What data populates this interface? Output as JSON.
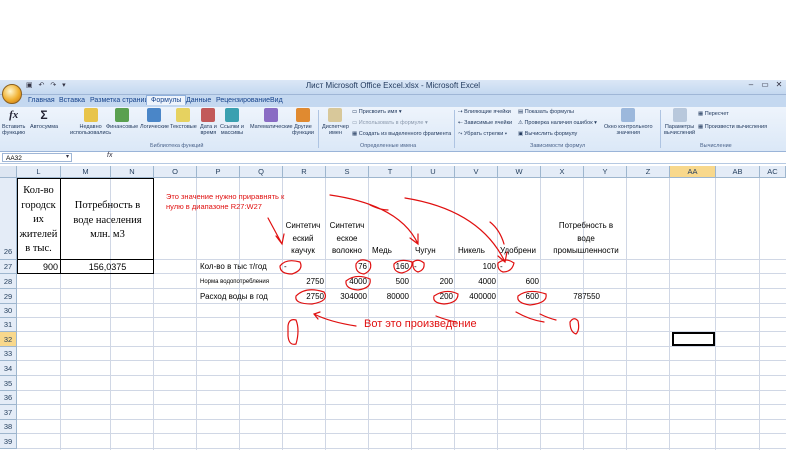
{
  "window": {
    "title": "Лист Microsoft Office Excel.xlsx - Microsoft Excel",
    "controls": [
      "–",
      "▭",
      "✕"
    ]
  },
  "tabs": [
    "Главная",
    "Вставка",
    "Разметка страницы",
    "Формулы",
    "Данные",
    "Рецензирование",
    "Вид"
  ],
  "ribbon": {
    "insert_function": [
      "Вставить",
      "функцию"
    ],
    "autosum": "Автосумма",
    "recent": [
      "Недавно",
      "использовались"
    ],
    "financial": "Финансовые",
    "logical": "Логические",
    "text": "Текстовые",
    "datetime": [
      "Дата и",
      "время"
    ],
    "lookup": [
      "Ссылки и",
      "массивы"
    ],
    "math": "Математические",
    "more": [
      "Другие",
      "функции"
    ],
    "group_library": "Библиотека функций",
    "name_manager": [
      "Диспетчер",
      "имен"
    ],
    "define_name": "Присвоить имя",
    "use_in_formula": "Использовать в формуле",
    "create_from_selection": "Создать из выделенного фрагмента",
    "group_names": "Определенные имена",
    "trace_precedents": "Влияющие ячейки",
    "trace_dependents": "Зависимые ячейки",
    "remove_arrows": "Убрать стрелки",
    "show_formulas": "Показать формулы",
    "error_checking": "Проверка наличия ошибок",
    "evaluate_formula": "Вычислить формулу",
    "group_audit": "Зависимости формул",
    "watch_window": [
      "Окно контрольного",
      "значения"
    ],
    "calc_options": [
      "Параметры",
      "вычислений"
    ],
    "calc_now": "Пересчет",
    "calc_sheet": "Произвести вычисления",
    "group_calc": "Вычисление"
  },
  "formula_bar": {
    "name_box": "AA32",
    "fx": "fx"
  },
  "columns": [
    "L",
    "M",
    "N",
    "O",
    "P",
    "Q",
    "R",
    "S",
    "T",
    "U",
    "V",
    "W",
    "X",
    "Y",
    "Z",
    "AA",
    "AB",
    "AC"
  ],
  "selected_column": "AA",
  "rows": [
    "26",
    "27",
    "28",
    "29",
    "30",
    "31",
    "32",
    "33",
    "34",
    "35",
    "36",
    "37",
    "38",
    "39"
  ],
  "selected_row": "32",
  "cells": {
    "L26": [
      "Кол-во",
      "городск",
      "их",
      "жителей",
      "в тыс."
    ],
    "M26": [
      "Потребность в",
      "воде населения",
      "млн. м3"
    ],
    "R26": [
      "Синтетич",
      "еский",
      "каучук"
    ],
    "S26": [
      "Синтетич",
      "еское",
      "волокно"
    ],
    "T26": "Медь",
    "U26": "Чугун",
    "V26": "Никель",
    "W26": "Удобрени",
    "X26": [
      "Потребность в",
      "воде",
      "промышленности"
    ],
    "L27": "900",
    "M27": "156,0375",
    "P27": "Кол-во в тыс т/год",
    "R27": "-",
    "S27": "76",
    "T27": "160",
    "U27": "-",
    "V27": "100",
    "W27": "-",
    "P28": "Норма водопотребления",
    "R28": "2750",
    "S28": "4000",
    "T28": "500",
    "U28": "200",
    "V28": "4000",
    "W28": "600",
    "P29": "Расход воды в год",
    "R29": "2750",
    "S29": "304000",
    "T29": "80000",
    "U29": "200",
    "V29": "400000",
    "W29": "600",
    "X29": "787550"
  },
  "annotations": {
    "note_line1": "Это значение нужно приравнять к",
    "note_line2": "нулю в диапазоне R27:W27",
    "product": "Вот это произведение"
  },
  "colors": {
    "annotation": "#e01010",
    "selected_header": "#f8d88c",
    "header_bg": "#e4ecf7"
  }
}
